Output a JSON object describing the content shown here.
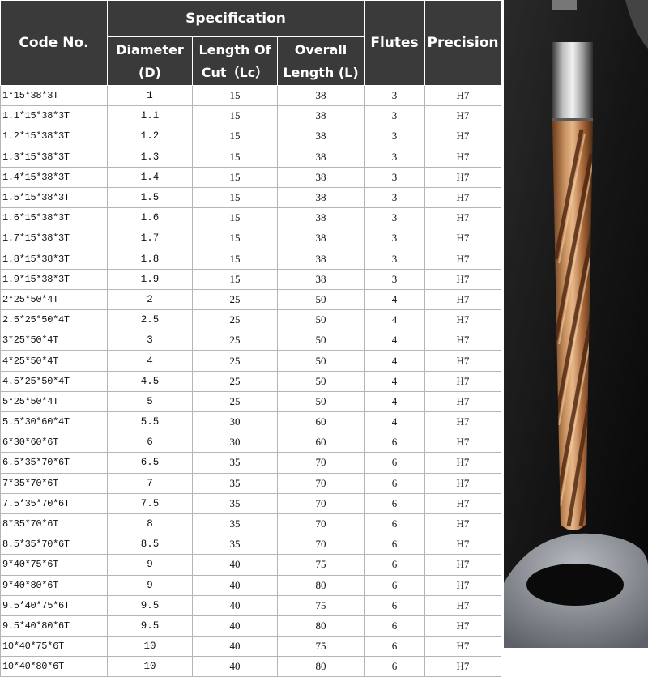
{
  "header": {
    "code_no": "Code No.",
    "specification": "Specification",
    "diameter": [
      "Diameter",
      "(D)"
    ],
    "length_of_cut": [
      "Length Of",
      "Cut（Lc）"
    ],
    "overall_length": [
      "Overall",
      "Length (L)"
    ],
    "flutes": "Flutes",
    "precision": "Precision"
  },
  "rows": [
    [
      "1*15*38*3T",
      "1",
      "15",
      "38",
      "3",
      "H7"
    ],
    [
      "1.1*15*38*3T",
      "1.1",
      "15",
      "38",
      "3",
      "H7"
    ],
    [
      "1.2*15*38*3T",
      "1.2",
      "15",
      "38",
      "3",
      "H7"
    ],
    [
      "1.3*15*38*3T",
      "1.3",
      "15",
      "38",
      "3",
      "H7"
    ],
    [
      "1.4*15*38*3T",
      "1.4",
      "15",
      "38",
      "3",
      "H7"
    ],
    [
      "1.5*15*38*3T",
      "1.5",
      "15",
      "38",
      "3",
      "H7"
    ],
    [
      "1.6*15*38*3T",
      "1.6",
      "15",
      "38",
      "3",
      "H7"
    ],
    [
      "1.7*15*38*3T",
      "1.7",
      "15",
      "38",
      "3",
      "H7"
    ],
    [
      "1.8*15*38*3T",
      "1.8",
      "15",
      "38",
      "3",
      "H7"
    ],
    [
      "1.9*15*38*3T",
      "1.9",
      "15",
      "38",
      "3",
      "H7"
    ],
    [
      "2*25*50*4T",
      "2",
      "25",
      "50",
      "4",
      "H7"
    ],
    [
      "2.5*25*50*4T",
      "2.5",
      "25",
      "50",
      "4",
      "H7"
    ],
    [
      "3*25*50*4T",
      "3",
      "25",
      "50",
      "4",
      "H7"
    ],
    [
      "4*25*50*4T",
      "4",
      "25",
      "50",
      "4",
      "H7"
    ],
    [
      "4.5*25*50*4T",
      "4.5",
      "25",
      "50",
      "4",
      "H7"
    ],
    [
      "5*25*50*4T",
      "5",
      "25",
      "50",
      "4",
      "H7"
    ],
    [
      "5.5*30*60*4T",
      "5.5",
      "30",
      "60",
      "4",
      "H7"
    ],
    [
      "6*30*60*6T",
      "6",
      "30",
      "60",
      "6",
      "H7"
    ],
    [
      "6.5*35*70*6T",
      "6.5",
      "35",
      "70",
      "6",
      "H7"
    ],
    [
      "7*35*70*6T",
      "7",
      "35",
      "70",
      "6",
      "H7"
    ],
    [
      "7.5*35*70*6T",
      "7.5",
      "35",
      "70",
      "6",
      "H7"
    ],
    [
      "8*35*70*6T",
      "8",
      "35",
      "70",
      "6",
      "H7"
    ],
    [
      "8.5*35*70*6T",
      "8.5",
      "35",
      "70",
      "6",
      "H7"
    ],
    [
      "9*40*75*6T",
      "9",
      "40",
      "75",
      "6",
      "H7"
    ],
    [
      "9*40*80*6T",
      "9",
      "40",
      "80",
      "6",
      "H7"
    ],
    [
      "9.5*40*75*6T",
      "9.5",
      "40",
      "75",
      "6",
      "H7"
    ],
    [
      "9.5*40*80*6T",
      "9.5",
      "40",
      "80",
      "6",
      "H7"
    ],
    [
      "10*40*75*6T",
      "10",
      "40",
      "75",
      "6",
      "H7"
    ],
    [
      "10*40*80*6T",
      "10",
      "40",
      "80",
      "6",
      "H7"
    ]
  ],
  "colors": {
    "header_bg": "#3a3a3a",
    "header_text": "#ffffff",
    "grid": "#b5b5b5",
    "coating": "#c08a5a"
  }
}
